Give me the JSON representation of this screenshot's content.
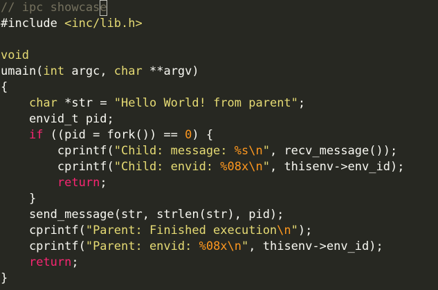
{
  "colors": {
    "background": "#272822",
    "default": "#f8f8f2",
    "comment": "#75715e",
    "type": "#e6db74",
    "keyword": "#f92672",
    "string": "#e6db74",
    "escape": "#fd971f",
    "number": "#fd971f",
    "include_path": "#e6db74"
  },
  "editor": {
    "lines": [
      [
        {
          "t": "// ipc showcas",
          "c": "comment"
        },
        {
          "t": "e",
          "c": "comment",
          "cursor": true
        }
      ],
      [
        {
          "t": "#include ",
          "c": "default"
        },
        {
          "t": "<inc/lib.h>",
          "c": "include_path"
        }
      ],
      [],
      [
        {
          "t": "void",
          "c": "type"
        }
      ],
      [
        {
          "t": "umain(",
          "c": "default"
        },
        {
          "t": "int",
          "c": "type"
        },
        {
          "t": " argc, ",
          "c": "default"
        },
        {
          "t": "char",
          "c": "type"
        },
        {
          "t": " **argv)",
          "c": "default"
        }
      ],
      [
        {
          "t": "{",
          "c": "default"
        }
      ],
      [
        {
          "t": "    ",
          "c": "default"
        },
        {
          "t": "char",
          "c": "type"
        },
        {
          "t": " *str = ",
          "c": "default"
        },
        {
          "t": "\"Hello World! from parent\"",
          "c": "string"
        },
        {
          "t": ";",
          "c": "default"
        }
      ],
      [
        {
          "t": "    envid_t pid;",
          "c": "default"
        }
      ],
      [
        {
          "t": "    ",
          "c": "default"
        },
        {
          "t": "if",
          "c": "keyword"
        },
        {
          "t": " ((pid = fork()) == ",
          "c": "default"
        },
        {
          "t": "0",
          "c": "number"
        },
        {
          "t": ") {",
          "c": "default"
        }
      ],
      [
        {
          "t": "        cprintf(",
          "c": "default"
        },
        {
          "t": "\"Child: message: ",
          "c": "string"
        },
        {
          "t": "%s\\n",
          "c": "escape"
        },
        {
          "t": "\"",
          "c": "string"
        },
        {
          "t": ", recv_message());",
          "c": "default"
        }
      ],
      [
        {
          "t": "        cprintf(",
          "c": "default"
        },
        {
          "t": "\"Child: envid: ",
          "c": "string"
        },
        {
          "t": "%08x\\n",
          "c": "escape"
        },
        {
          "t": "\"",
          "c": "string"
        },
        {
          "t": ", thisenv->env_id);",
          "c": "default"
        }
      ],
      [
        {
          "t": "        ",
          "c": "default"
        },
        {
          "t": "return",
          "c": "keyword"
        },
        {
          "t": ";",
          "c": "default"
        }
      ],
      [
        {
          "t": "    }",
          "c": "default"
        }
      ],
      [
        {
          "t": "    send_message(str, strlen(str), pid);",
          "c": "default"
        }
      ],
      [
        {
          "t": "    cprintf(",
          "c": "default"
        },
        {
          "t": "\"Parent: Finished execution",
          "c": "string"
        },
        {
          "t": "\\n",
          "c": "escape"
        },
        {
          "t": "\"",
          "c": "string"
        },
        {
          "t": ");",
          "c": "default"
        }
      ],
      [
        {
          "t": "    cprintf(",
          "c": "default"
        },
        {
          "t": "\"Parent: envid: ",
          "c": "string"
        },
        {
          "t": "%08x\\n",
          "c": "escape"
        },
        {
          "t": "\"",
          "c": "string"
        },
        {
          "t": ", thisenv->env_id);",
          "c": "default"
        }
      ],
      [
        {
          "t": "    ",
          "c": "default"
        },
        {
          "t": "return",
          "c": "keyword"
        },
        {
          "t": ";",
          "c": "default"
        }
      ],
      [
        {
          "t": "}",
          "c": "default"
        }
      ]
    ]
  }
}
